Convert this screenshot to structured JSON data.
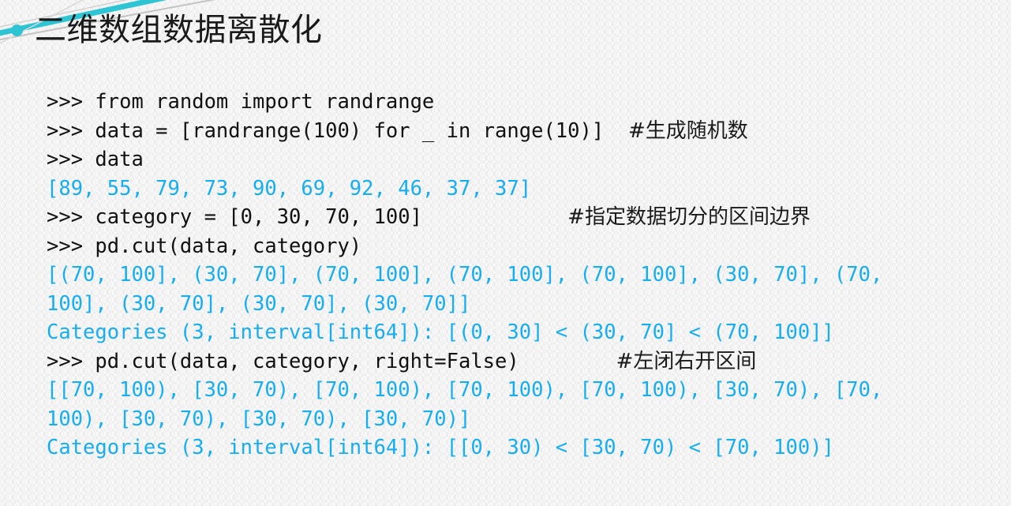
{
  "slide": {
    "title": "二维数组数据离散化",
    "bullet_color": "#2EC4D4",
    "background_color": "#f7f7f7",
    "input_text_color": "#111111",
    "output_text_color": "#16AEF0",
    "decor": {
      "teal_line_color": "#2EC4D4",
      "gray_line_color": "#b9b9b9"
    }
  },
  "console": {
    "lines": [
      {
        "kind": "input",
        "text": ">>> from random import randrange",
        "comment": "",
        "comment_gap": ""
      },
      {
        "kind": "input",
        "text": ">>> data = [randrange(100) for _ in range(10)]",
        "comment": "#生成随机数",
        "comment_gap": "  "
      },
      {
        "kind": "input",
        "text": ">>> data",
        "comment": "",
        "comment_gap": ""
      },
      {
        "kind": "output",
        "text": "[89, 55, 79, 73, 90, 69, 92, 46, 37, 37]",
        "comment": "",
        "comment_gap": ""
      },
      {
        "kind": "input",
        "text": ">>> category = [0, 30, 70, 100]",
        "comment": "#指定数据切分的区间边界",
        "comment_gap": "            "
      },
      {
        "kind": "input",
        "text": ">>> pd.cut(data, category)",
        "comment": "",
        "comment_gap": ""
      },
      {
        "kind": "output",
        "text": "[(70, 100], (30, 70], (70, 100], (70, 100], (70, 100], (30, 70], (70,",
        "comment": "",
        "comment_gap": ""
      },
      {
        "kind": "output",
        "text": "100], (30, 70], (30, 70], (30, 70]]",
        "comment": "",
        "comment_gap": ""
      },
      {
        "kind": "output",
        "text": "Categories (3, interval[int64]): [(0, 30] < (30, 70] < (70, 100]]",
        "comment": "",
        "comment_gap": ""
      },
      {
        "kind": "input",
        "text": ">>> pd.cut(data, category, right=False)",
        "comment": "#左闭右开区间",
        "comment_gap": "        "
      },
      {
        "kind": "output",
        "text": "[[70, 100), [30, 70), [70, 100), [70, 100), [70, 100), [30, 70), [70,",
        "comment": "",
        "comment_gap": ""
      },
      {
        "kind": "output",
        "text": "100), [30, 70), [30, 70), [30, 70)]",
        "comment": "",
        "comment_gap": ""
      },
      {
        "kind": "output",
        "text": "Categories (3, interval[int64]): [[0, 30) < [30, 70) < [70, 100)]",
        "comment": "",
        "comment_gap": ""
      }
    ]
  }
}
